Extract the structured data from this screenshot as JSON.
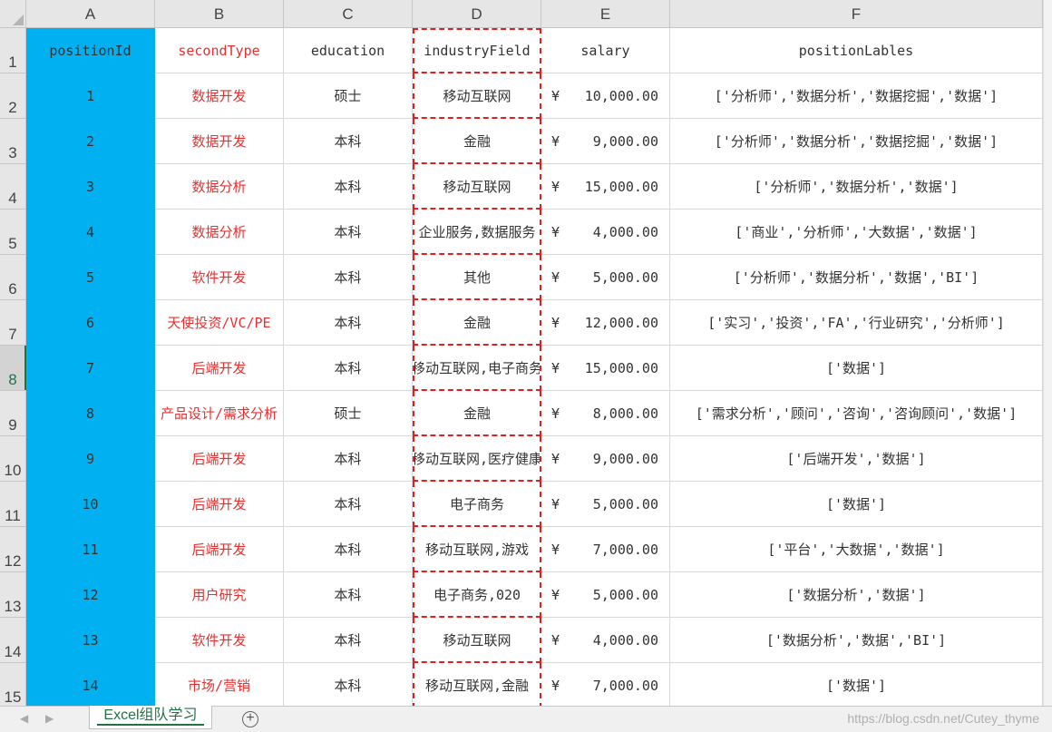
{
  "sheet": {
    "column_letters": [
      "A",
      "B",
      "C",
      "D",
      "E",
      "F"
    ],
    "selected_row": "8",
    "rows": [
      {
        "row": "1",
        "positionId": "positionId",
        "secondType": "secondType",
        "education": "education",
        "industryField": "industryField",
        "currency": "",
        "salary": "salary",
        "positionLables": "positionLables"
      },
      {
        "row": "2",
        "positionId": "1",
        "secondType": "数据开发",
        "education": "硕士",
        "industryField": "移动互联网",
        "currency": "¥",
        "salary": "10,000.00",
        "positionLables": "['分析师','数据分析','数据挖掘','数据']"
      },
      {
        "row": "3",
        "positionId": "2",
        "secondType": "数据开发",
        "education": "本科",
        "industryField": "金融",
        "currency": "¥",
        "salary": "9,000.00",
        "positionLables": "['分析师','数据分析','数据挖掘','数据']"
      },
      {
        "row": "4",
        "positionId": "3",
        "secondType": "数据分析",
        "education": "本科",
        "industryField": "移动互联网",
        "currency": "¥",
        "salary": "15,000.00",
        "positionLables": "['分析师','数据分析','数据']"
      },
      {
        "row": "5",
        "positionId": "4",
        "secondType": "数据分析",
        "education": "本科",
        "industryField": "企业服务,数据服务",
        "currency": "¥",
        "salary": "4,000.00",
        "positionLables": "['商业','分析师','大数据','数据']"
      },
      {
        "row": "6",
        "positionId": "5",
        "secondType": "软件开发",
        "education": "本科",
        "industryField": "其他",
        "currency": "¥",
        "salary": "5,000.00",
        "positionLables": "['分析师','数据分析','数据','BI']"
      },
      {
        "row": "7",
        "positionId": "6",
        "secondType": "天使投资/VC/PE",
        "education": "本科",
        "industryField": "金融",
        "currency": "¥",
        "salary": "12,000.00",
        "positionLables": "['实习','投资','FA','行业研究','分析师']"
      },
      {
        "row": "8",
        "positionId": "7",
        "secondType": "后端开发",
        "education": "本科",
        "industryField": "移动互联网,电子商务",
        "currency": "¥",
        "salary": "15,000.00",
        "positionLables": "['数据']"
      },
      {
        "row": "9",
        "positionId": "8",
        "secondType": "产品设计/需求分析",
        "education": "硕士",
        "industryField": "金融",
        "currency": "¥",
        "salary": "8,000.00",
        "positionLables": "['需求分析','顾问','咨询','咨询顾问','数据']"
      },
      {
        "row": "10",
        "positionId": "9",
        "secondType": "后端开发",
        "education": "本科",
        "industryField": "移动互联网,医疗健康",
        "currency": "¥",
        "salary": "9,000.00",
        "positionLables": "['后端开发','数据']"
      },
      {
        "row": "11",
        "positionId": "10",
        "secondType": "后端开发",
        "education": "本科",
        "industryField": "电子商务",
        "currency": "¥",
        "salary": "5,000.00",
        "positionLables": "['数据']"
      },
      {
        "row": "12",
        "positionId": "11",
        "secondType": "后端开发",
        "education": "本科",
        "industryField": "移动互联网,游戏",
        "currency": "¥",
        "salary": "7,000.00",
        "positionLables": "['平台','大数据','数据']"
      },
      {
        "row": "13",
        "positionId": "12",
        "secondType": "用户研究",
        "education": "本科",
        "industryField": "电子商务,020",
        "currency": "¥",
        "salary": "5,000.00",
        "positionLables": "['数据分析','数据']"
      },
      {
        "row": "14",
        "positionId": "13",
        "secondType": "软件开发",
        "education": "本科",
        "industryField": "移动互联网",
        "currency": "¥",
        "salary": "4,000.00",
        "positionLables": "['数据分析','数据','BI']"
      },
      {
        "row": "15",
        "positionId": "14",
        "secondType": "市场/营销",
        "education": "本科",
        "industryField": "移动互联网,金融",
        "currency": "¥",
        "salary": "7,000.00",
        "positionLables": "['数据']"
      }
    ]
  },
  "tabs": {
    "active_sheet": "Excel组队学习",
    "add_sheet_icon": "plus-circle-icon",
    "prev_icon": "triangle-left-icon",
    "next_icon": "triangle-right-icon"
  },
  "watermark": "https://blog.csdn.net/Cutey_thyme",
  "colors": {
    "column_a_fill": "#00b0f0",
    "second_type_text": "#e83030",
    "selection_border": "#e02020",
    "excel_green": "#217346"
  }
}
